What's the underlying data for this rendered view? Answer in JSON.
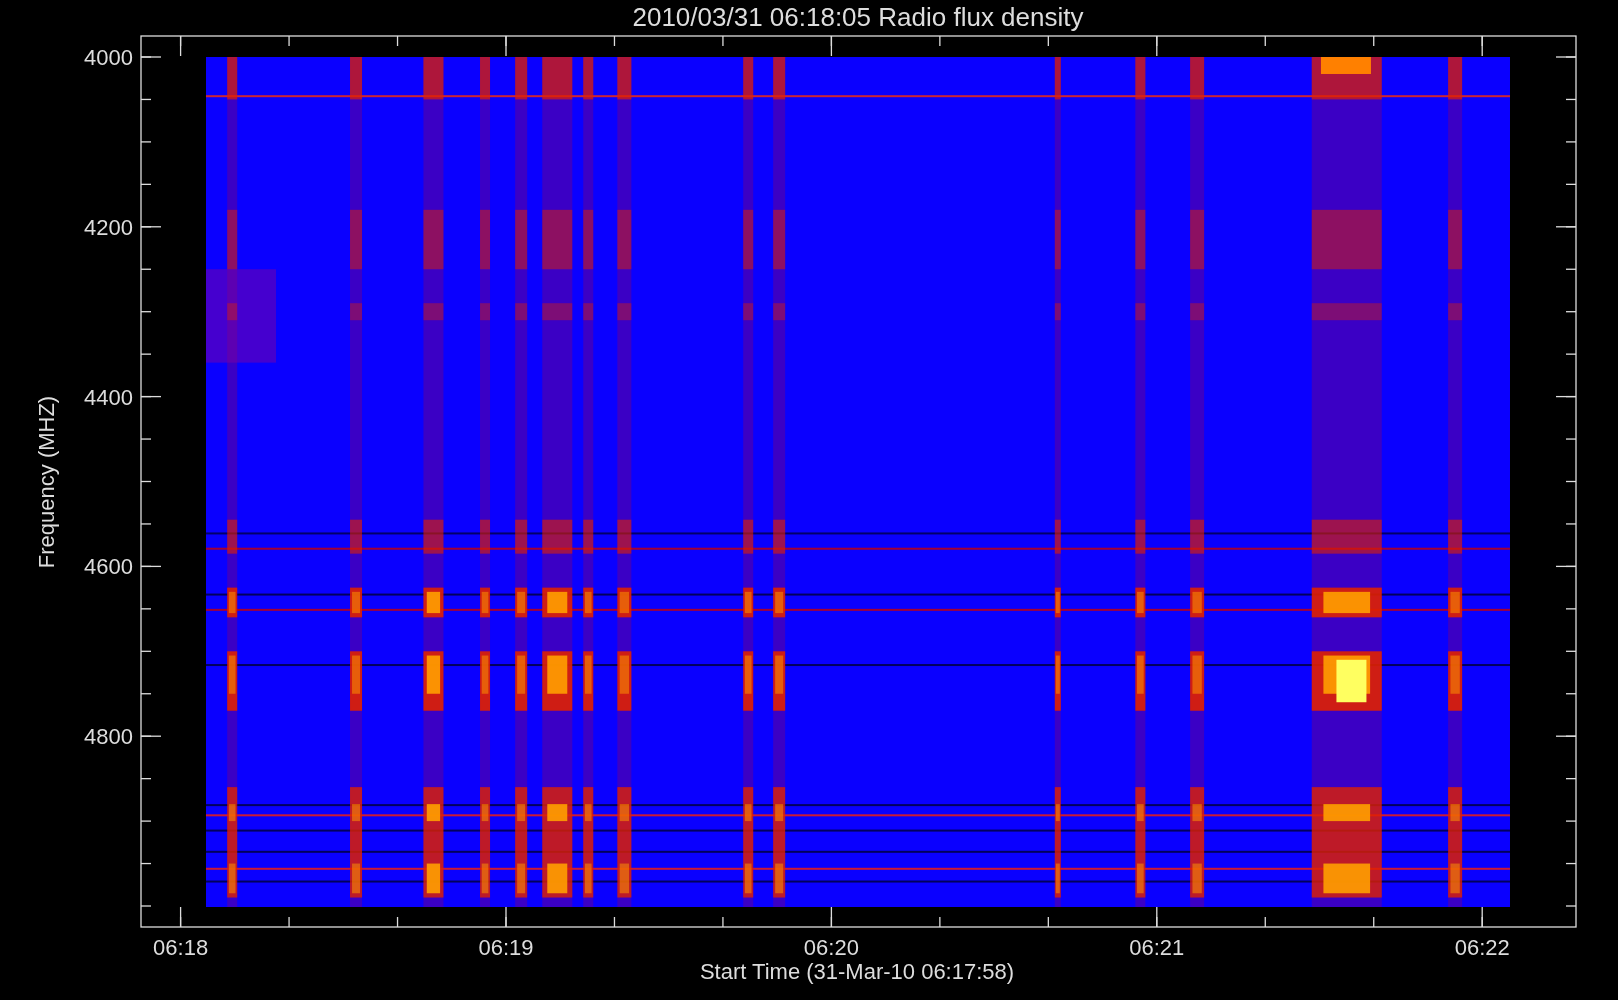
{
  "title": "2010/03/31 06:18:05 Radio flux density",
  "y_axis": {
    "label": "Frequency (MHZ)",
    "ticks": [
      "4000",
      "4200",
      "4400",
      "4600",
      "4800"
    ]
  },
  "x_axis": {
    "label": "Start Time (31-Mar-10 06:17:58)",
    "ticks": [
      "06:18",
      "06:19",
      "06:20",
      "06:21",
      "06:22"
    ]
  }
}
